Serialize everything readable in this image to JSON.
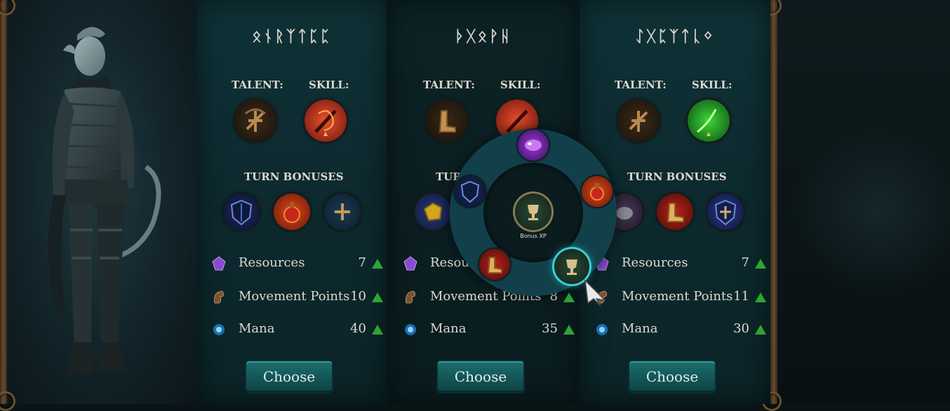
{
  "colors": {
    "accent_teal": "#135556",
    "up_arrow_green": "#2fa535",
    "panel_bg": "#0f3237"
  },
  "heroes": [
    {
      "name": "ᛟᚾᚱᛉᛏᛈᛈ",
      "talent_label": "TALENT:",
      "skill_label": "SKILL:",
      "talent_icon": "crossed-bow-icon",
      "skill_icon": "flaming-sword-icon",
      "turn_bonuses_label": "TURN BONUSES",
      "turn_bonus_icons": [
        "shield-icon",
        "fire-potion-icon",
        "blue-cross-icon"
      ],
      "stats": [
        {
          "label": "Resources",
          "value": "7",
          "icon": "purple-crystal-icon"
        },
        {
          "label": "Movement Points",
          "value": "10",
          "icon": "horse-icon"
        },
        {
          "label": "Mana",
          "value": "40",
          "icon": "mana-orb-icon"
        }
      ],
      "button": "Choose"
    },
    {
      "name": "ᚦᚷᛟᚹᚺ",
      "talent_label": "TALENT:",
      "skill_label": "SKILL:",
      "talent_icon": "boots-icon",
      "skill_icon": "flaming-sword-icon",
      "turn_bonuses_label": "TURN BONUSES",
      "turn_bonus_icons": [
        "gold-ore-icon",
        "blue-swirl-icon"
      ],
      "stats": [
        {
          "label": "Resources",
          "value": "",
          "icon": "purple-crystal-icon"
        },
        {
          "label": "Movement Points",
          "value": "8",
          "icon": "horse-icon"
        },
        {
          "label": "Mana",
          "value": "35",
          "icon": "mana-orb-icon"
        }
      ],
      "button": "Choose"
    },
    {
      "name": "ᛇᚷᛈᛉᛏᚳᛜ",
      "talent_label": "TALENT:",
      "skill_label": "SKILL:",
      "talent_icon": "crossed-bow-icon",
      "skill_icon": "green-magic-icon",
      "turn_bonuses_label": "TURN BONUSES",
      "turn_bonus_icons": [
        "stone-ore-icon",
        "boots-icon",
        "shield-cross-icon"
      ],
      "stats": [
        {
          "label": "Resources",
          "value": "7",
          "icon": "purple-crystal-icon"
        },
        {
          "label": "Movement Points",
          "value": "11",
          "icon": "horse-icon"
        },
        {
          "label": "Mana",
          "value": "30",
          "icon": "mana-orb-icon"
        }
      ],
      "button": "Choose"
    }
  ],
  "radial_menu": {
    "center_label": "Bonus XP",
    "center_icon": "trophy-icon",
    "options": [
      "purple-gem-icon",
      "fire-potion-icon",
      "trophy-icon",
      "boots-icon",
      "shield-icon"
    ]
  }
}
